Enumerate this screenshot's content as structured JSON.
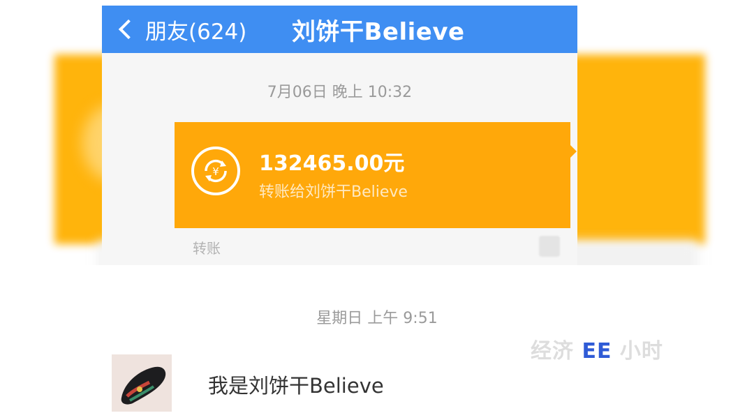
{
  "header": {
    "back_label": "朋友(624)",
    "title": "刘饼干Believe"
  },
  "chat": {
    "timestamp_1": "7月06日 晚上 10:32",
    "transfer": {
      "amount": "132465.00元",
      "subtitle": "转账给刘饼干Believe",
      "label": "转账"
    },
    "timestamp_2": "星期日 上午 9:51",
    "message_text": "我是刘饼干Believe"
  },
  "watermark": {
    "prefix": "经济",
    "mark": "EE",
    "suffix": "小时"
  },
  "colors": {
    "nav_blue": "#3f8ef2",
    "transfer_orange": "#ffa80a"
  },
  "icons": [
    "chevron-left-icon",
    "transfer-yuan-icon"
  ]
}
